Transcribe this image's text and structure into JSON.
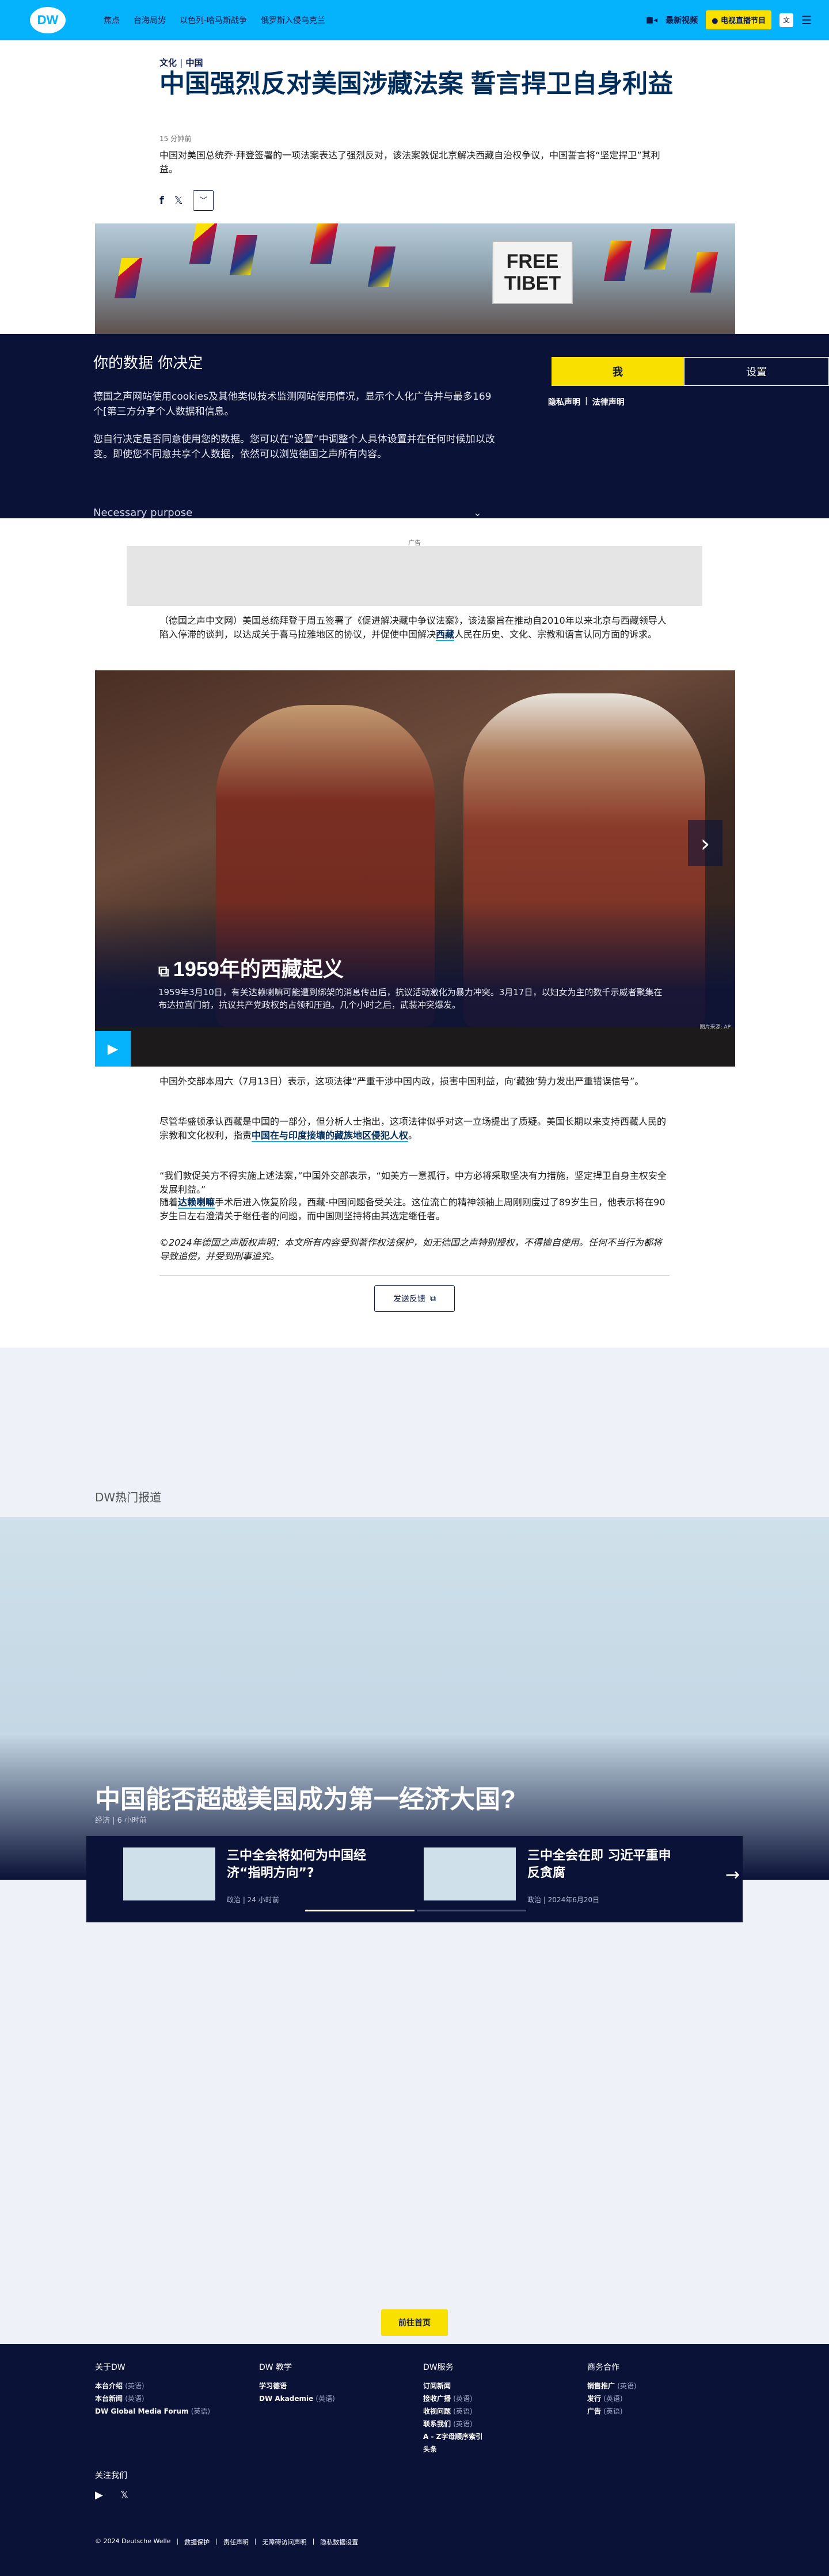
{
  "header": {
    "logo": "DW",
    "nav": [
      "焦点",
      "台海局势",
      "以色列-哈马斯战争",
      "俄罗斯入侵乌克兰"
    ],
    "live_video": "最新视频",
    "tv_live": "电视直播节目",
    "lang_icon": "文"
  },
  "article": {
    "category": "文化",
    "separator": "|",
    "region": "中国",
    "title": "中国强烈反对美国涉藏法案 誓言捍卫自身利益",
    "time_ago": "15 分钟前",
    "lead": "中国对美国总统乔·拜登签署的一项法案表达了强烈反对，该法案敦促北京解决西藏自治权争议，中国誓言将“坚定捍卫”其利益。",
    "hero_sign": "FREE TIBET",
    "para1_a": "（德国之声中文网）美国总统拜登于周五签署了《促进解决藏中争议法案》，该法案旨在推动自2010年以来北京与西藏领导人陷入停滞的谈判，以达成关于喜马拉雅地区的协议，并促使中国解决",
    "para1_link": "西藏",
    "para1_b": "人民在历史、文化、宗教和语言认同方面的诉求。",
    "ad_label": "广告",
    "para2": "中国外交部本周六（7月13日）表示，这项法律“严重干涉中国内政，损害中国利益，向‘藏独’势力发出严重错误信号”。",
    "para3_a": "尽管华盛顿承认西藏是中国的一部分，但分析人士指出，这项法律似乎对这一立场提出了质疑。美国长期以来支持西藏人民的宗教和文化权利，指责",
    "para3_link": "中国在与印度接壤的藏族地区侵犯人权",
    "para3_b": "。",
    "para4": "“我们敦促美方不得实施上述法案，”中国外交部表示，“如美方一意孤行，中方必将采取坚决有力措施，坚定捍卫自身主权安全发展利益。”",
    "para5_a": "随着",
    "para5_link": "达赖喇嘛",
    "para5_b": "手术后进入恢复阶段，西藏-中国问题备受关注。这位流亡的精神领袖上周刚刚度过了89岁生日，他表示将在90岁生日左右澄清关于继任者的问题，而中国则坚持将由其选定继任者。",
    "disclaimer": "©2024年德国之声版权声明：本文所有内容受到著作权法保护，如无德国之声特别授权，不得擅自使用。任何不当行为都将导致追偿，并受到刑事追究。",
    "feedback": "发送反馈"
  },
  "cookie": {
    "title": "你的数据 你决定",
    "p1": "德国之声网站使用cookies及其他类似技术监测网站使用情况，显示个人化广告并与最多169 个[第三方分享个人数据和信息。",
    "p2": "您自行决定是否同意使用您的数据。您可以在“设置”中调整个人具体设置并在任何时候加以改变。即使您不同意共享个人数据，依然可以浏览德国之声所有内容。",
    "accept": "我",
    "settings": "设置",
    "privacy": "隐私声明",
    "link_sep": "|",
    "legal": "法律声明",
    "purpose": "Necessary purpose"
  },
  "gallery": {
    "title": "1959年的西藏起义",
    "text": "1959年3月10日，有关达赖喇嘛可能遭到绑架的消息传出后，抗议活动激化为暴力冲突。3月17日，以妇女为主的数千示威者聚集在布达拉宫门前，抗议共产党政权的占领和压迫。几个小时之后，武装冲突爆发。",
    "credit": "图片来源: AP"
  },
  "related": {
    "label": "DW热门报道",
    "title": "中国能否超越美国成为第一经济大国?",
    "meta": "经济 | 6 小时前",
    "cards": [
      {
        "title": "三中全会将如何为中国经济“指明方向”?",
        "meta": "政治 | 24 小时前"
      },
      {
        "title": "三中全会在即 习近平重申反贪腐",
        "meta": "政治 | 2024年6月20日"
      }
    ]
  },
  "back_top": "前往首页",
  "footer": {
    "cols": [
      {
        "head": "关于DW",
        "items": [
          {
            "t": "本台介绍",
            "s": "(英语)"
          },
          {
            "t": "本台新闻",
            "s": "(英语)"
          },
          {
            "t": "DW Global Media Forum",
            "s": "(英语)"
          }
        ]
      },
      {
        "head": "DW 教学",
        "items": [
          {
            "t": "学习德语",
            "s": ""
          },
          {
            "t": "DW Akademie",
            "s": "(英语)"
          }
        ]
      },
      {
        "head": "DW服务",
        "items": [
          {
            "t": "订阅新闻",
            "s": ""
          },
          {
            "t": "接收广播",
            "s": "(英语)"
          },
          {
            "t": "收视问题",
            "s": "(英语)"
          },
          {
            "t": "联系我们",
            "s": "(英语)"
          },
          {
            "t": "A - Z字母顺序索引",
            "s": ""
          },
          {
            "t": "头条",
            "s": ""
          }
        ]
      },
      {
        "head": "商务合作",
        "items": [
          {
            "t": "销售推广",
            "s": "(英语)"
          },
          {
            "t": "发行",
            "s": "(英语)"
          },
          {
            "t": "广告",
            "s": "(英语)"
          }
        ]
      }
    ],
    "follow": "关注我们",
    "legal": [
      "© 2024 Deutsche Welle",
      "数据保护",
      "责任声明",
      "无障碍访问声明",
      "隐私数据设置"
    ]
  }
}
